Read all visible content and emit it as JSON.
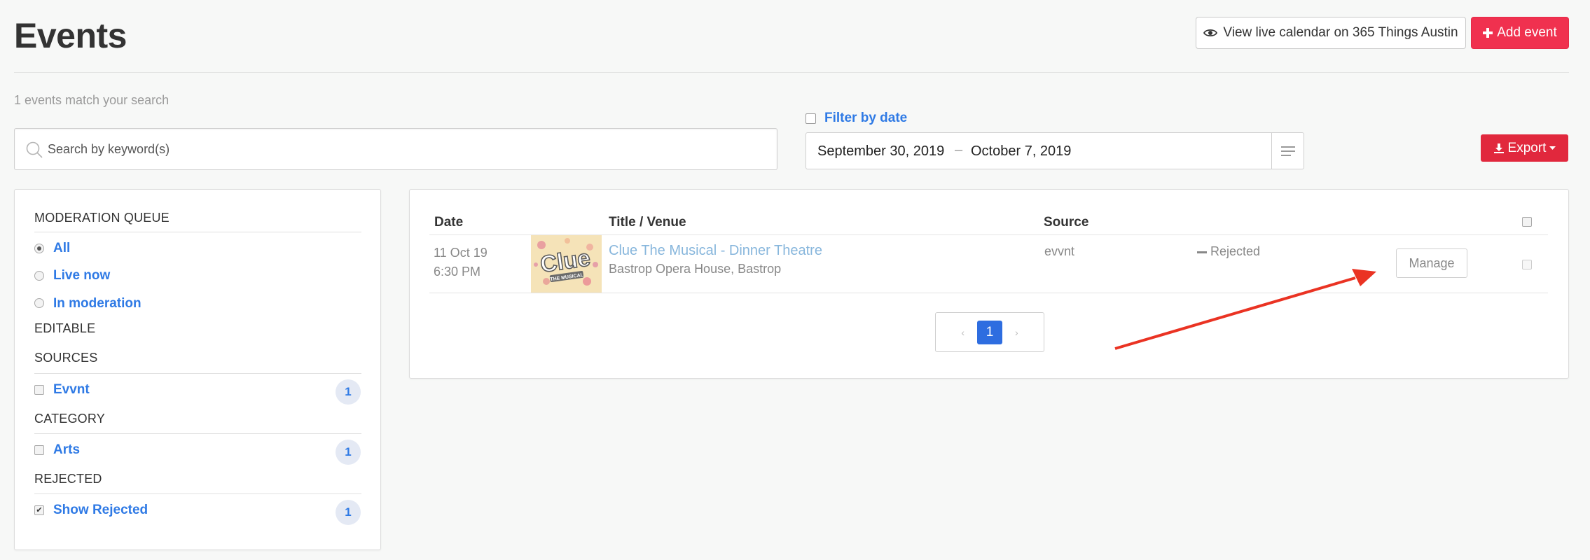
{
  "page": {
    "title": "Events"
  },
  "header": {
    "view_live_label": "View live calendar on 365 Things Austin",
    "add_event_label": "Add event"
  },
  "search": {
    "match_count": "1 events match your search",
    "placeholder": "Search by keyword(s)",
    "value": ""
  },
  "date_filter": {
    "label": "Filter by date",
    "checked": false,
    "start": "September 30, 2019",
    "separator": "–",
    "end": "October 7, 2019"
  },
  "export": {
    "label": "Export"
  },
  "sidebar": {
    "moderation_heading": "MODERATION QUEUE",
    "moderation_options": [
      {
        "label": "All",
        "selected": true
      },
      {
        "label": "Live now",
        "selected": false
      },
      {
        "label": "In moderation",
        "selected": false
      }
    ],
    "editable_heading": "EDITABLE",
    "sources_heading": "SOURCES",
    "sources": [
      {
        "label": "Evvnt",
        "count": "1",
        "checked": false
      }
    ],
    "category_heading": "CATEGORY",
    "categories": [
      {
        "label": "Arts",
        "count": "1",
        "checked": false
      }
    ],
    "rejected_heading": "REJECTED",
    "rejected": [
      {
        "label": "Show Rejected",
        "count": "1",
        "checked": true
      }
    ]
  },
  "table": {
    "headers": {
      "date": "Date",
      "title_venue": "Title / Venue",
      "source": "Source"
    },
    "rows": [
      {
        "date": "11 Oct 19",
        "time": "6:30 PM",
        "thumbnail_text": "Clue",
        "thumbnail_subtext": "THE MUSICAL",
        "title": "Clue The Musical - Dinner Theatre",
        "venue": "Bastrop Opera House, Bastrop",
        "source": "evvnt",
        "status": "Rejected",
        "manage_label": "Manage"
      }
    ]
  },
  "pagination": {
    "prev": "‹",
    "current": "1",
    "next": "›"
  },
  "colors": {
    "accent": "#2f7ae5",
    "add_button": "#f0314f",
    "export_button": "#e1283d",
    "annotation_arrow": "#ea3323"
  }
}
